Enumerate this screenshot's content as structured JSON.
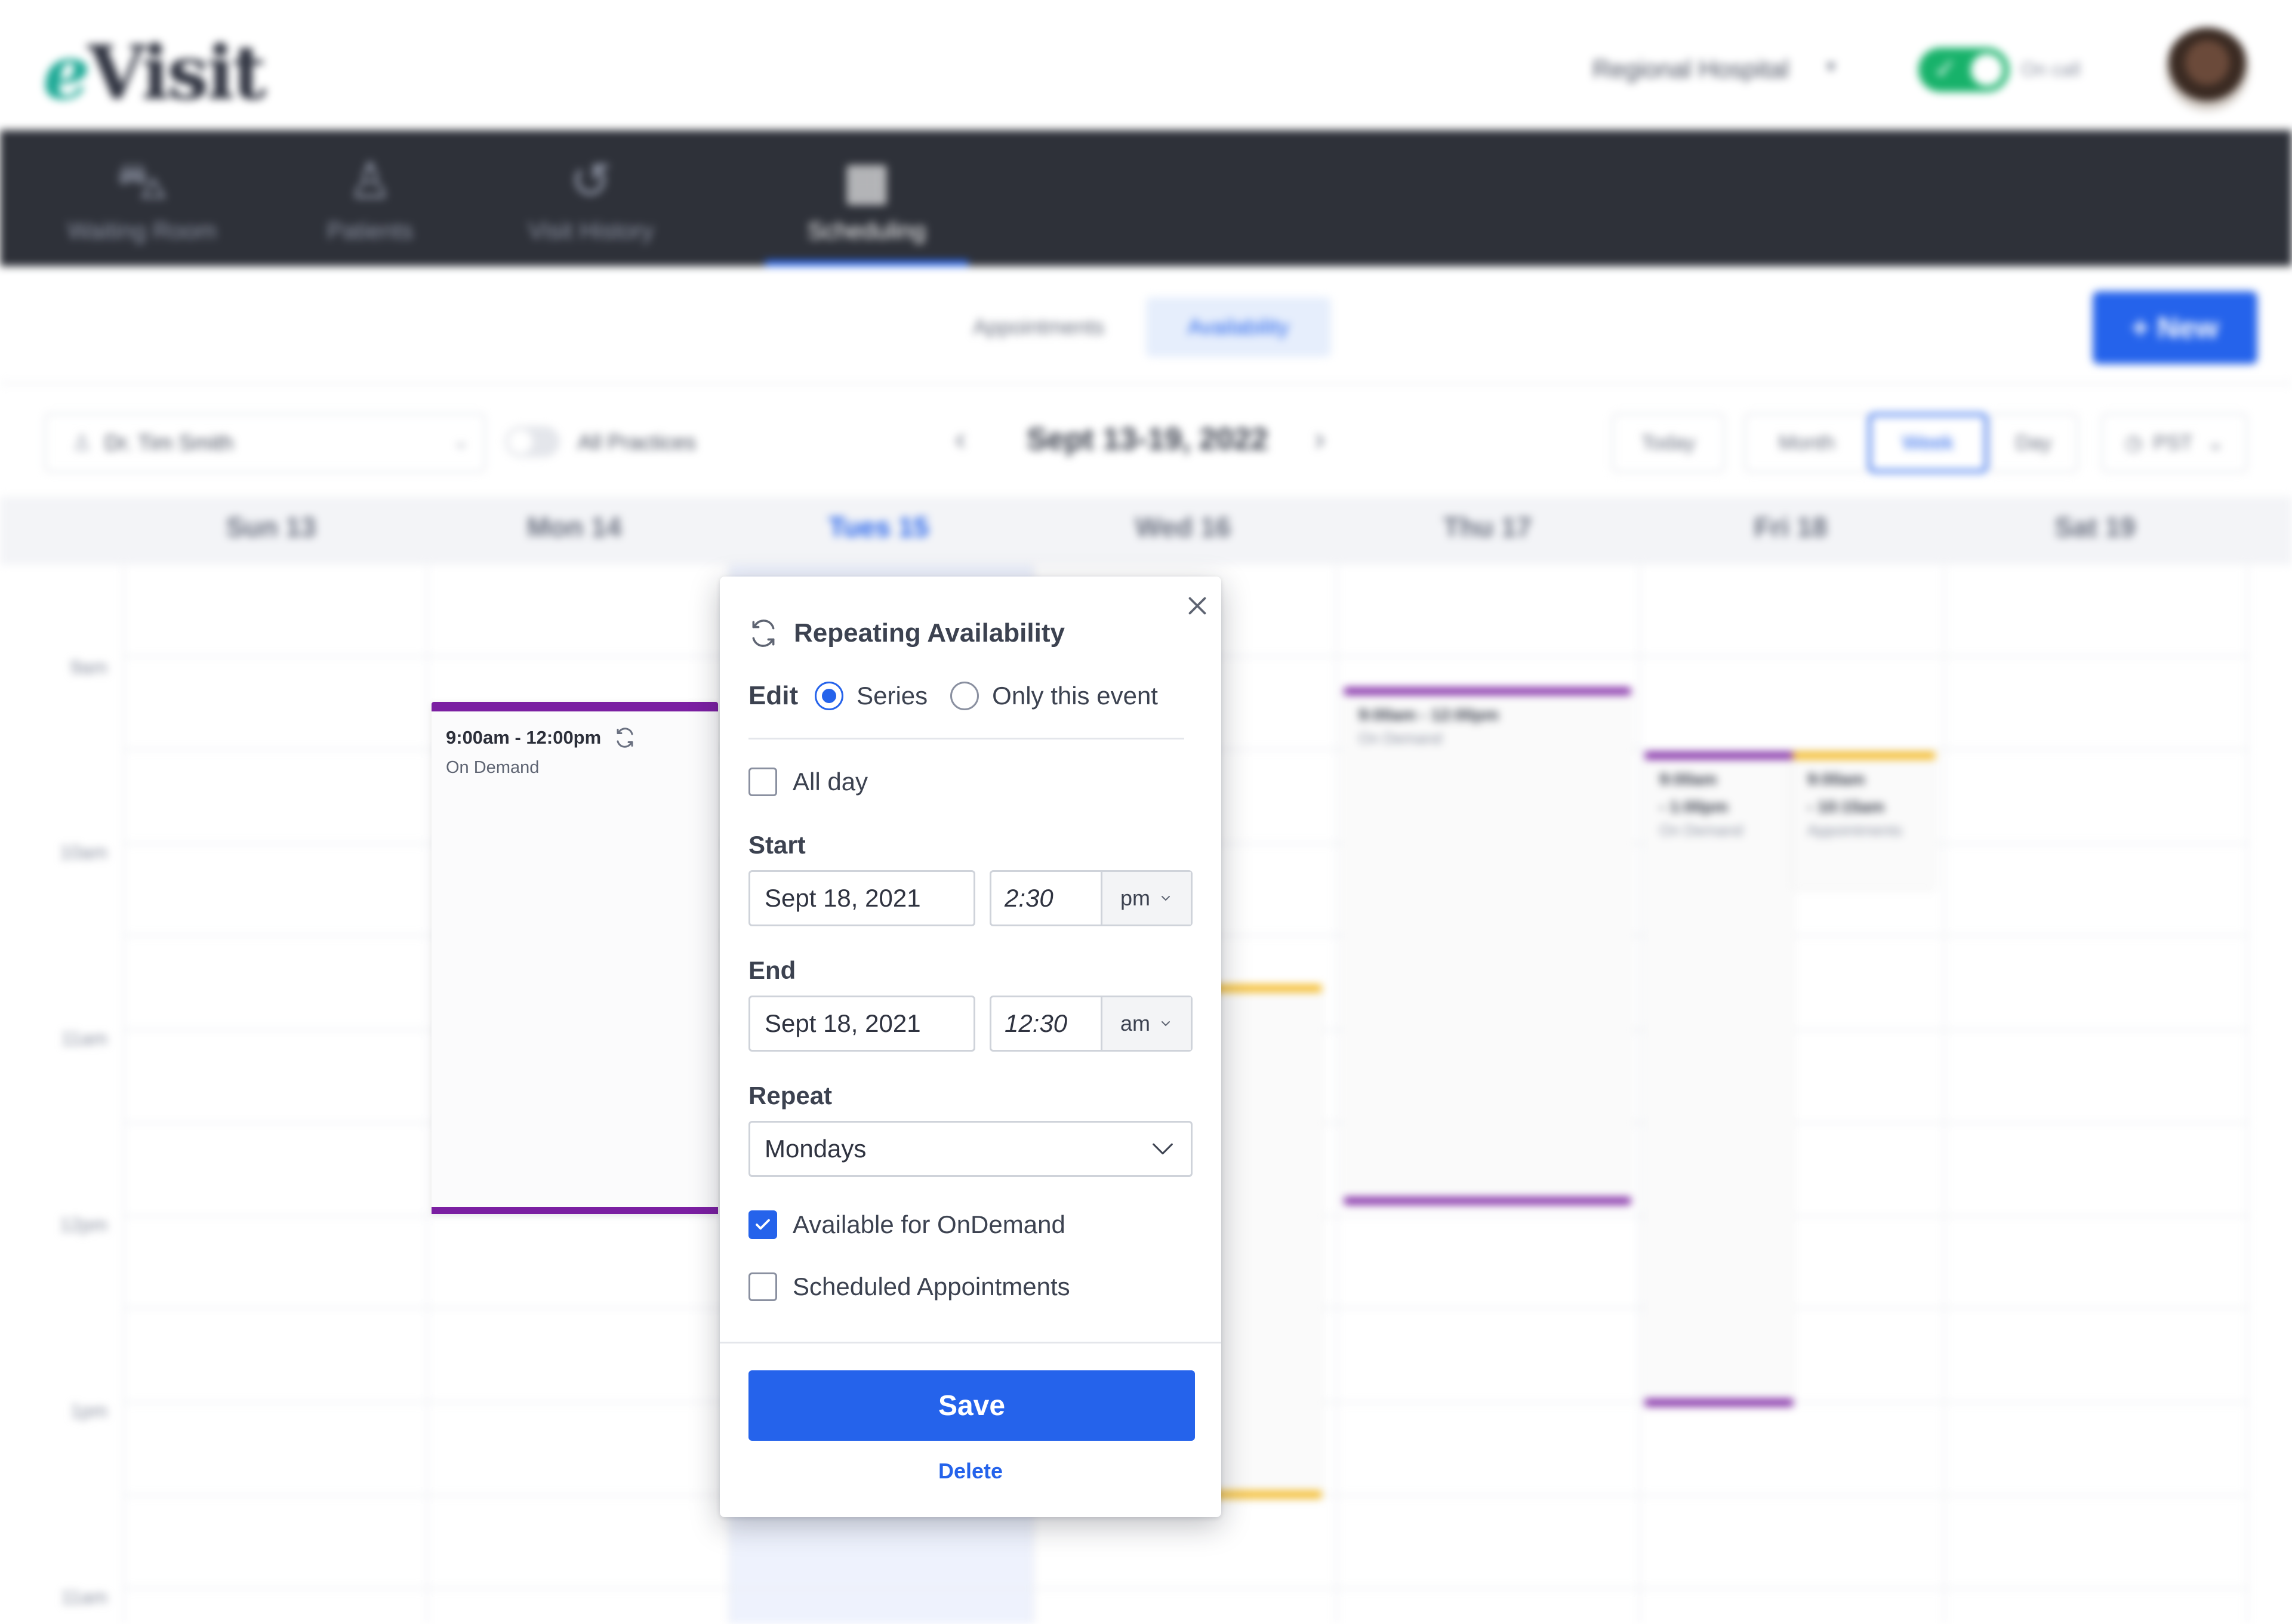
{
  "header": {
    "logo_e": "e",
    "logo_rest": "Visit",
    "hospital": "Regional Hospital",
    "on_call_label": "On call"
  },
  "nav": {
    "items": [
      {
        "label": "Waiting Room",
        "icon": "car-icon"
      },
      {
        "label": "Patients",
        "icon": "user-icon"
      },
      {
        "label": "Visit History",
        "icon": "history-icon"
      },
      {
        "label": "Scheduling",
        "icon": "calendar-icon",
        "active": true
      }
    ]
  },
  "subtabs": {
    "appointments": "Appointments",
    "availability": "Availability"
  },
  "new_button": "+ New",
  "toolbar": {
    "doctor": "Dr. Tim Smith",
    "all_practices": "All Practices",
    "date_range": "Sept 13-19, 2022",
    "today": "Today",
    "month": "Month",
    "week": "Week",
    "day": "Day",
    "timezone": "PST"
  },
  "days": [
    "Sun 13",
    "Mon 14",
    "Tues 15",
    "Wed 16",
    "Thu 17",
    "Fri 18",
    "Sat 19"
  ],
  "hours": [
    "9am",
    "10am",
    "11am",
    "12pm",
    "1pm",
    "11am"
  ],
  "events": {
    "mon": {
      "time": "9:00am - 12:00pm",
      "type": "On Demand"
    },
    "thu": {
      "time": "9:00am - 12:00pm",
      "type": "On Demand"
    },
    "fri_a": {
      "time1": "9:00am",
      "time2": "- 1:00pm",
      "type": "On Demand"
    },
    "fri_b": {
      "time1": "9:00am",
      "time2": "- 10:15am",
      "type": "Appointments"
    }
  },
  "colors": {
    "primary": "#2563eb",
    "on_demand_bar": "#7b1fa2",
    "appointments_bar": "#f5b81b",
    "nav_bg": "#2e3139"
  },
  "modal": {
    "title": "Repeating Availability",
    "edit_label": "Edit",
    "series_label": "Series",
    "only_event_label": "Only this event",
    "edit_selected": "Series",
    "all_day_label": "All day",
    "all_day_checked": false,
    "start_label": "Start",
    "start_date": "Sept 18, 2021",
    "start_time": "2:30",
    "start_ampm": "pm",
    "end_label": "End",
    "end_date": "Sept 18, 2021",
    "end_time": "12:30",
    "end_ampm": "am",
    "repeat_label": "Repeat",
    "repeat_value": "Mondays",
    "ondemand_label": "Available for OnDemand",
    "ondemand_checked": true,
    "scheduled_label": "Scheduled Appointments",
    "scheduled_checked": false,
    "save_label": "Save",
    "delete_label": "Delete"
  }
}
